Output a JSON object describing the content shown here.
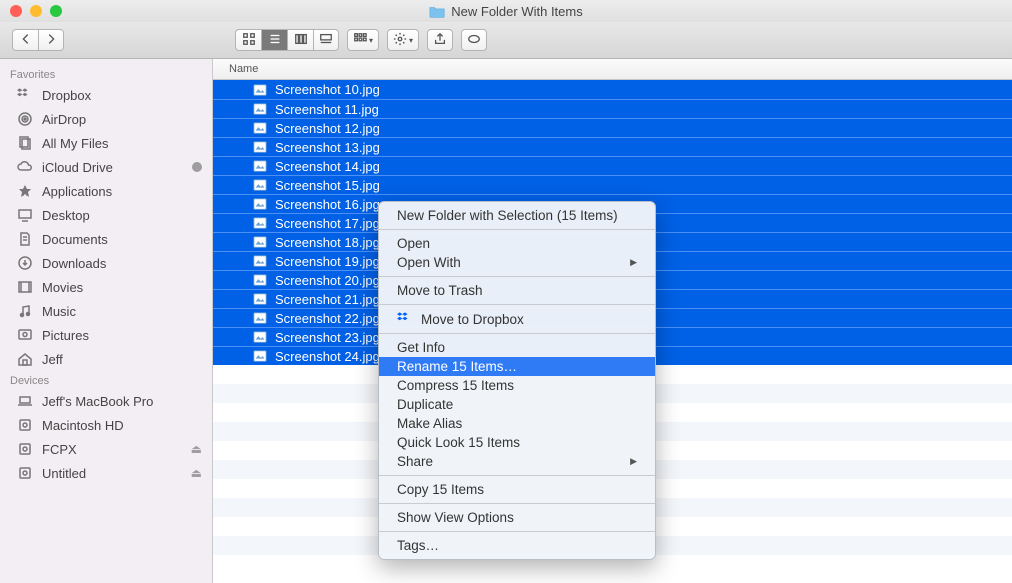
{
  "window": {
    "title": "New Folder With Items"
  },
  "toolbar": {
    "column_header": "Name"
  },
  "sidebar": {
    "sections": [
      {
        "heading": "Favorites",
        "items": [
          {
            "icon": "dropbox",
            "label": "Dropbox"
          },
          {
            "icon": "airdrop",
            "label": "AirDrop"
          },
          {
            "icon": "files",
            "label": "All My Files"
          },
          {
            "icon": "cloud",
            "label": "iCloud Drive",
            "badge": true
          },
          {
            "icon": "apps",
            "label": "Applications"
          },
          {
            "icon": "desktop",
            "label": "Desktop"
          },
          {
            "icon": "documents",
            "label": "Documents"
          },
          {
            "icon": "downloads",
            "label": "Downloads"
          },
          {
            "icon": "movies",
            "label": "Movies"
          },
          {
            "icon": "music",
            "label": "Music"
          },
          {
            "icon": "pictures",
            "label": "Pictures"
          },
          {
            "icon": "home",
            "label": "Jeff"
          }
        ]
      },
      {
        "heading": "Devices",
        "items": [
          {
            "icon": "laptop",
            "label": "Jeff's MacBook Pro"
          },
          {
            "icon": "disk",
            "label": "Macintosh HD"
          },
          {
            "icon": "disk",
            "label": "FCPX",
            "eject": true
          },
          {
            "icon": "disk",
            "label": "Untitled",
            "eject": true
          }
        ]
      }
    ]
  },
  "files": [
    "Screenshot 10.jpg",
    "Screenshot 11.jpg",
    "Screenshot 12.jpg",
    "Screenshot 13.jpg",
    "Screenshot 14.jpg",
    "Screenshot 15.jpg",
    "Screenshot 16.jpg",
    "Screenshot 17.jpg",
    "Screenshot 18.jpg",
    "Screenshot 19.jpg",
    "Screenshot 20.jpg",
    "Screenshot 21.jpg",
    "Screenshot 22.jpg",
    "Screenshot 23.jpg",
    "Screenshot 24.jpg"
  ],
  "empty_rows": 11,
  "context_menu": {
    "groups": [
      [
        {
          "label": "New Folder with Selection (15 Items)"
        }
      ],
      [
        {
          "label": "Open"
        },
        {
          "label": "Open With",
          "arrow": true
        }
      ],
      [
        {
          "label": "Move to Trash"
        }
      ],
      [
        {
          "label": "Move to Dropbox",
          "icon": "dropbox"
        }
      ],
      [
        {
          "label": "Get Info"
        },
        {
          "label": "Rename 15 Items…",
          "selected": true
        },
        {
          "label": "Compress 15 Items"
        },
        {
          "label": "Duplicate"
        },
        {
          "label": "Make Alias"
        },
        {
          "label": "Quick Look 15 Items"
        },
        {
          "label": "Share",
          "arrow": true
        }
      ],
      [
        {
          "label": "Copy 15 Items"
        }
      ],
      [
        {
          "label": "Show View Options"
        }
      ],
      [
        {
          "label": "Tags…"
        }
      ]
    ]
  }
}
